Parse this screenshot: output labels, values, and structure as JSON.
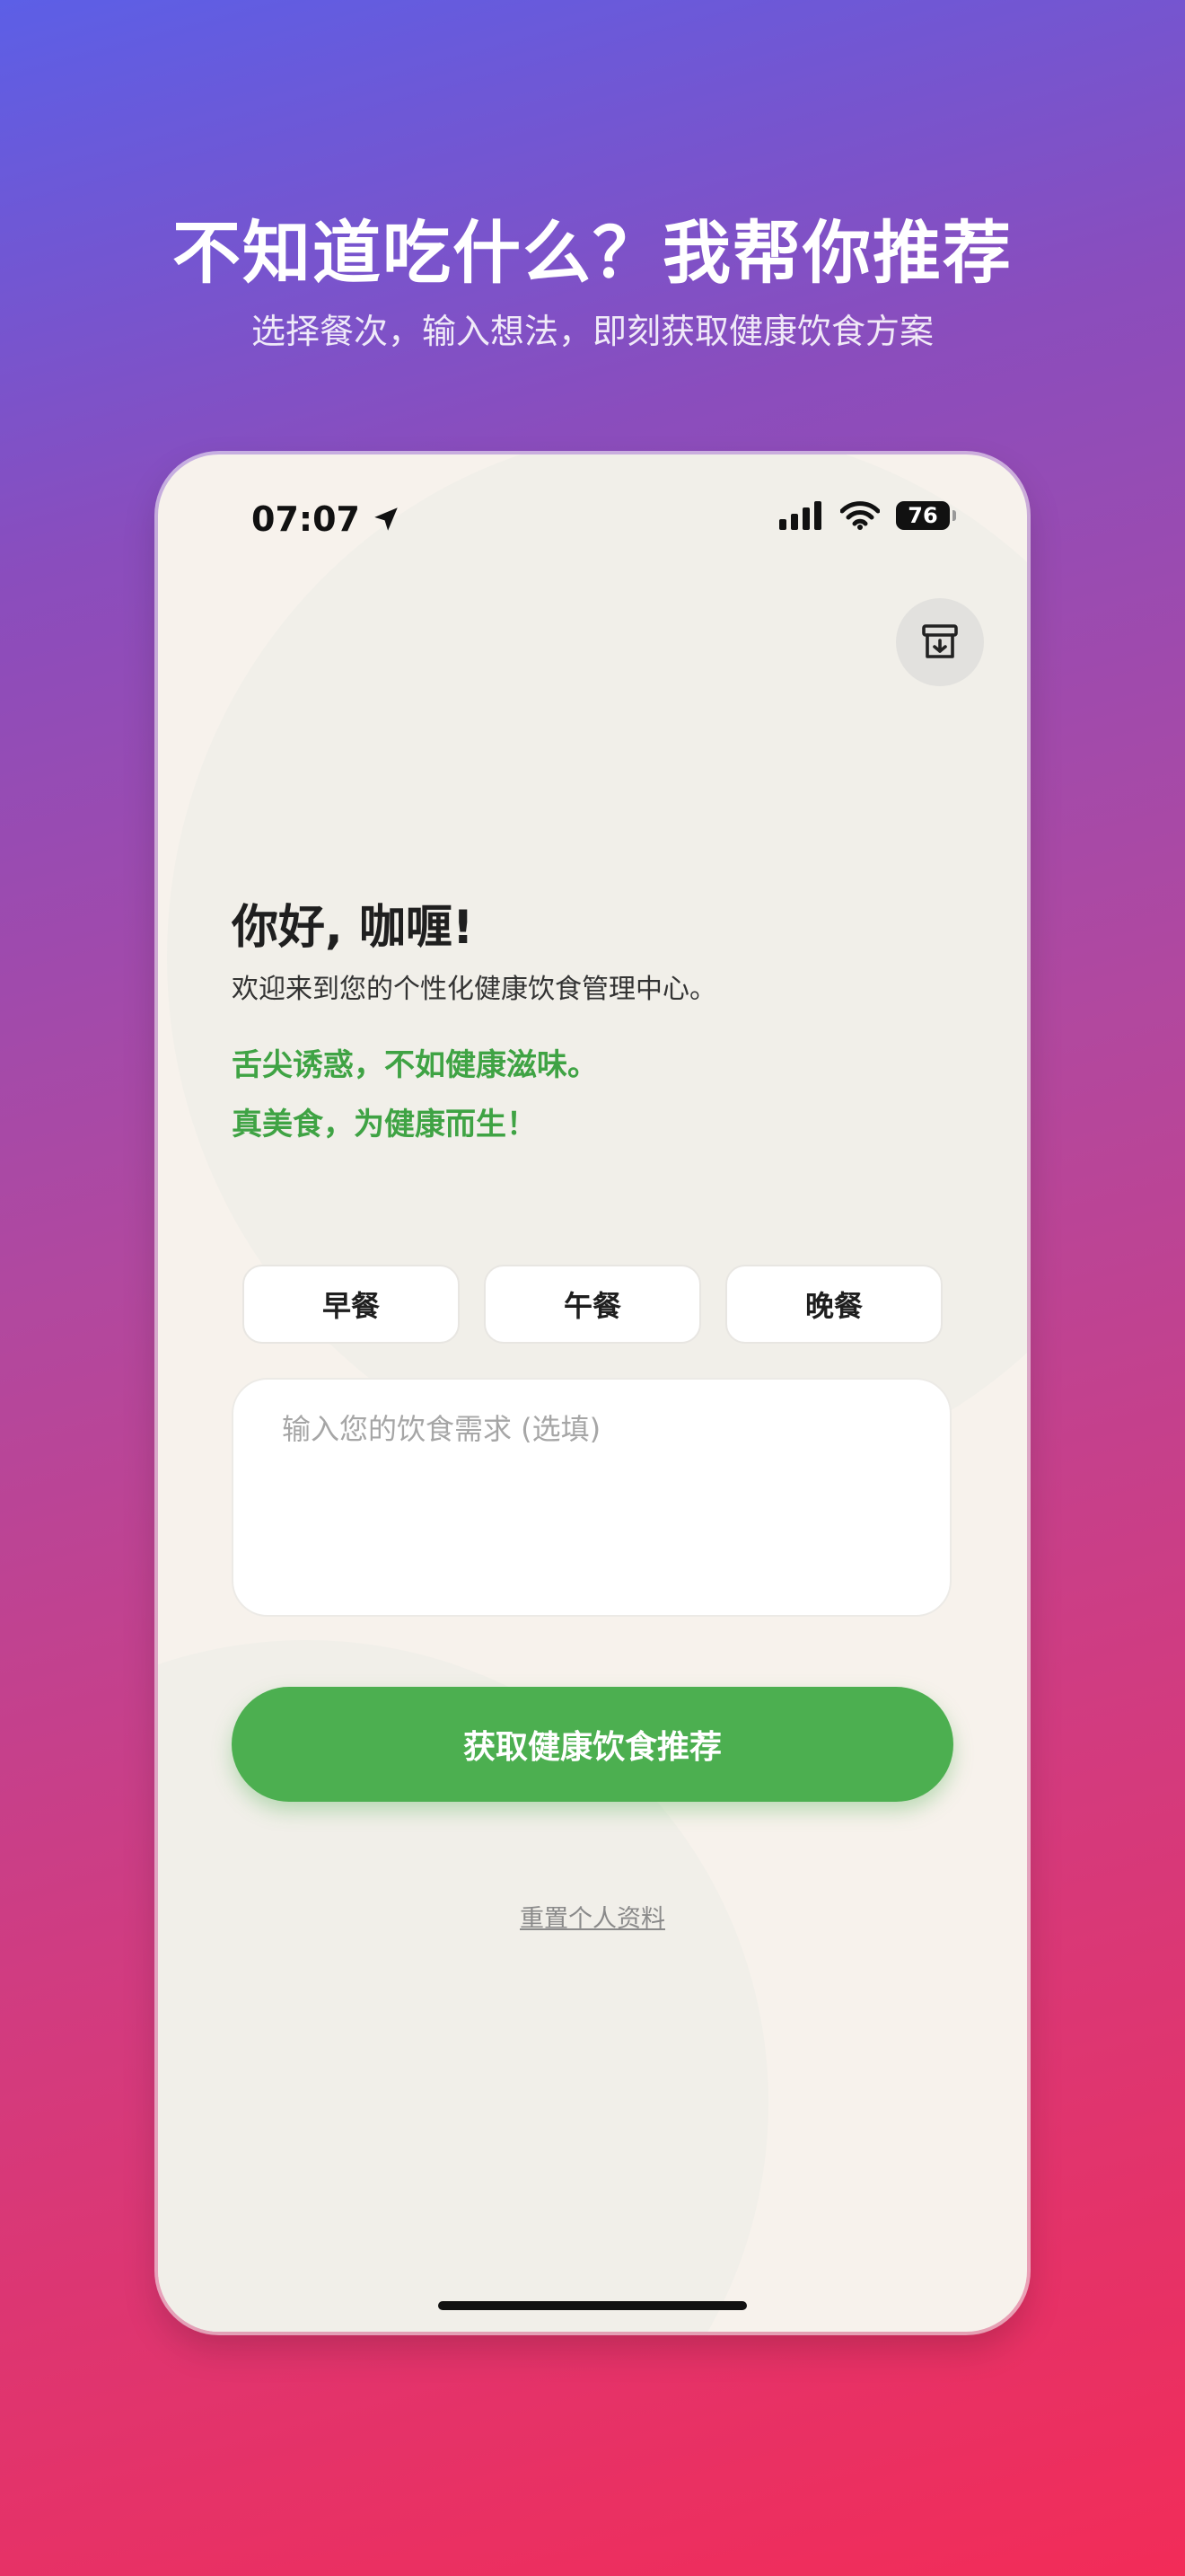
{
  "promo": {
    "headline": "不知道吃什么？我帮你推荐",
    "subheadline": "选择餐次，输入想法，即刻获取健康饮食方案"
  },
  "status_bar": {
    "time": "07:07",
    "battery": "76"
  },
  "header": {
    "archive_icon": "archive-download-icon"
  },
  "main": {
    "greeting": "你好, 咖喱!",
    "welcome": "欢迎来到您的个性化健康饮食管理中心。",
    "slogan_line1": "舌尖诱惑，不如健康滋味。",
    "slogan_line2": "真美食，为健康而生！",
    "meals": [
      "早餐",
      "午餐",
      "晚餐"
    ],
    "input_placeholder": "输入您的饮食需求 (选填)",
    "submit_label": "获取健康饮食推荐",
    "reset_label": "重置个人资料"
  },
  "colors": {
    "accent_green": "#4caf50",
    "slogan_green": "#3fa344",
    "phone_bg": "#f7f2ec"
  }
}
